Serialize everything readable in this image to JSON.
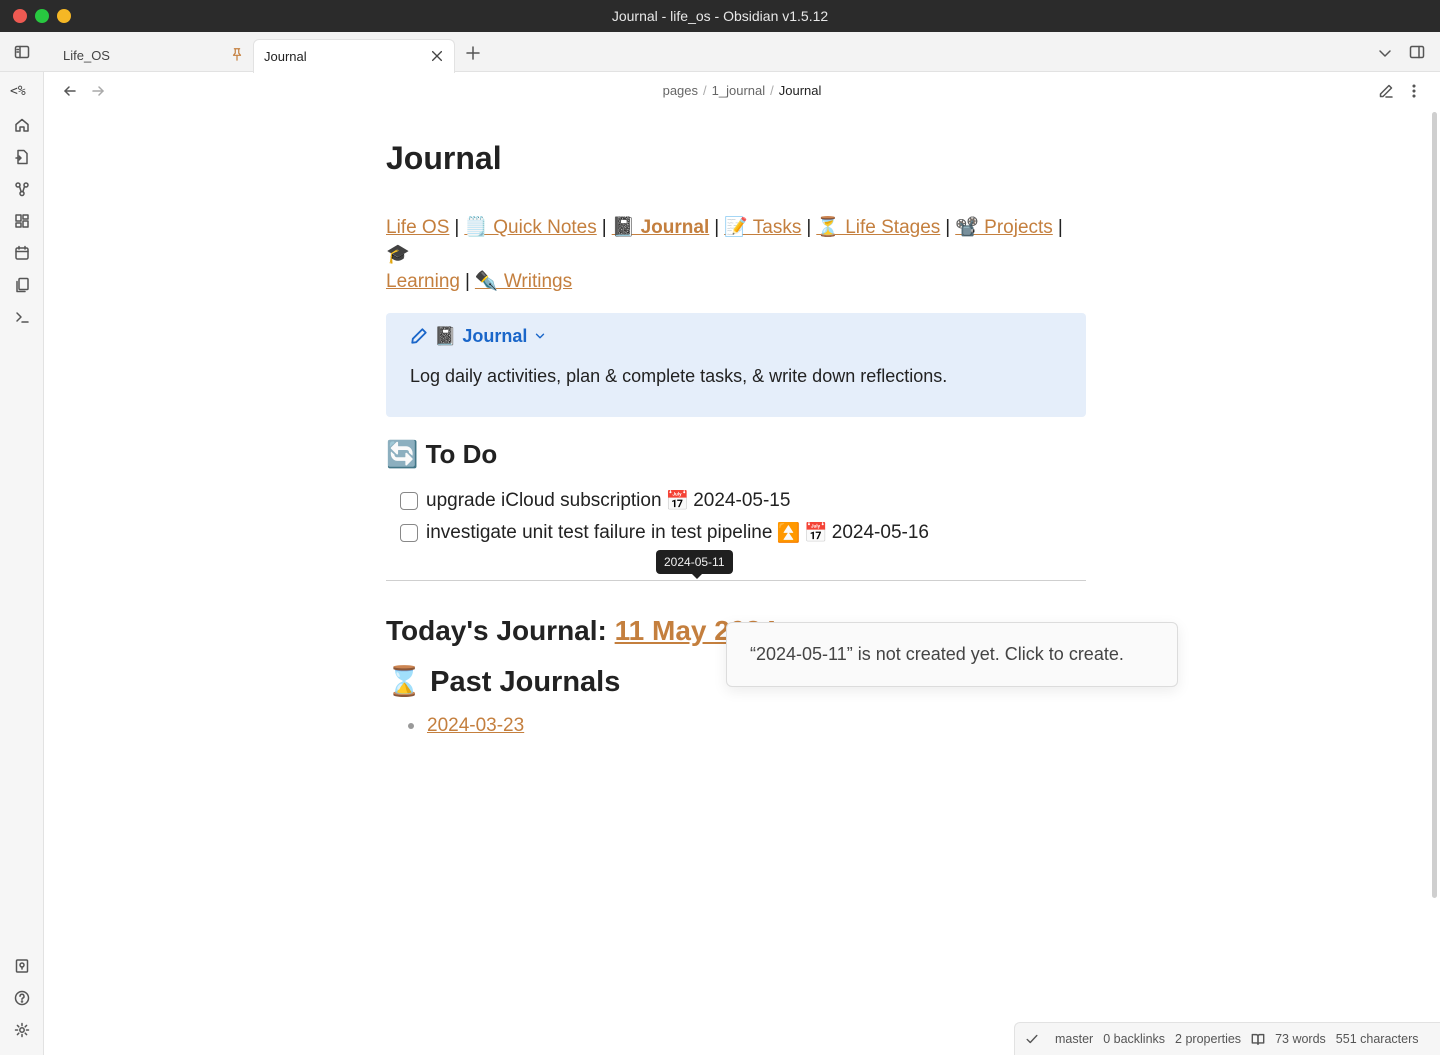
{
  "window": {
    "title": "Journal - life_os - Obsidian v1.5.12"
  },
  "tabs": [
    {
      "label": "Life_OS",
      "pinned": true
    },
    {
      "label": "Journal",
      "active": true
    }
  ],
  "ribbon": {
    "templater_label": "<%"
  },
  "breadcrumb": {
    "parts": [
      "pages",
      "1_journal"
    ],
    "separator": "/",
    "current": "Journal"
  },
  "note": {
    "title": "Journal",
    "nav": {
      "life_os": "Life OS",
      "quick_notes": "🗒️ Quick Notes",
      "journal": "📓 Journal",
      "tasks": "📝 Tasks",
      "life_stages": "⏳ Life Stages",
      "projects": "📽️ Projects",
      "learning_emoji": "🎓",
      "learning": "Learning",
      "writings": "✒️ Writings",
      "separator": "|"
    },
    "callout": {
      "emoji": "📓",
      "title": "Journal",
      "body": "Log daily activities, plan & complete tasks, & write down reflections."
    },
    "todo": {
      "heading": "🔄 To Do",
      "tasks": [
        {
          "text": "upgrade iCloud subscription",
          "priority": "",
          "date_icon": "📅",
          "date": "2024-05-15",
          "done": false
        },
        {
          "text": "investigate unit test failure in test pipeline",
          "priority": "⏫",
          "date_icon": "📅",
          "date": "2024-05-16",
          "done": false
        }
      ]
    },
    "today": {
      "label": "Today's Journal:",
      "link": "11 May 2024"
    },
    "past": {
      "heading": "⌛ Past Journals",
      "items": [
        "2024-03-23"
      ]
    }
  },
  "tooltip": {
    "text": "2024-05-11"
  },
  "popover": {
    "text": "“2024-05-11” is not created yet. Click to create."
  },
  "status_bar": {
    "branch": "master",
    "backlinks": "0 backlinks",
    "properties": "2 properties",
    "words": "73 words",
    "characters": "551 characters"
  },
  "colors": {
    "link": "#c47f3e",
    "callout_bg": "#e5eefa",
    "callout_title": "#1a66c9"
  }
}
